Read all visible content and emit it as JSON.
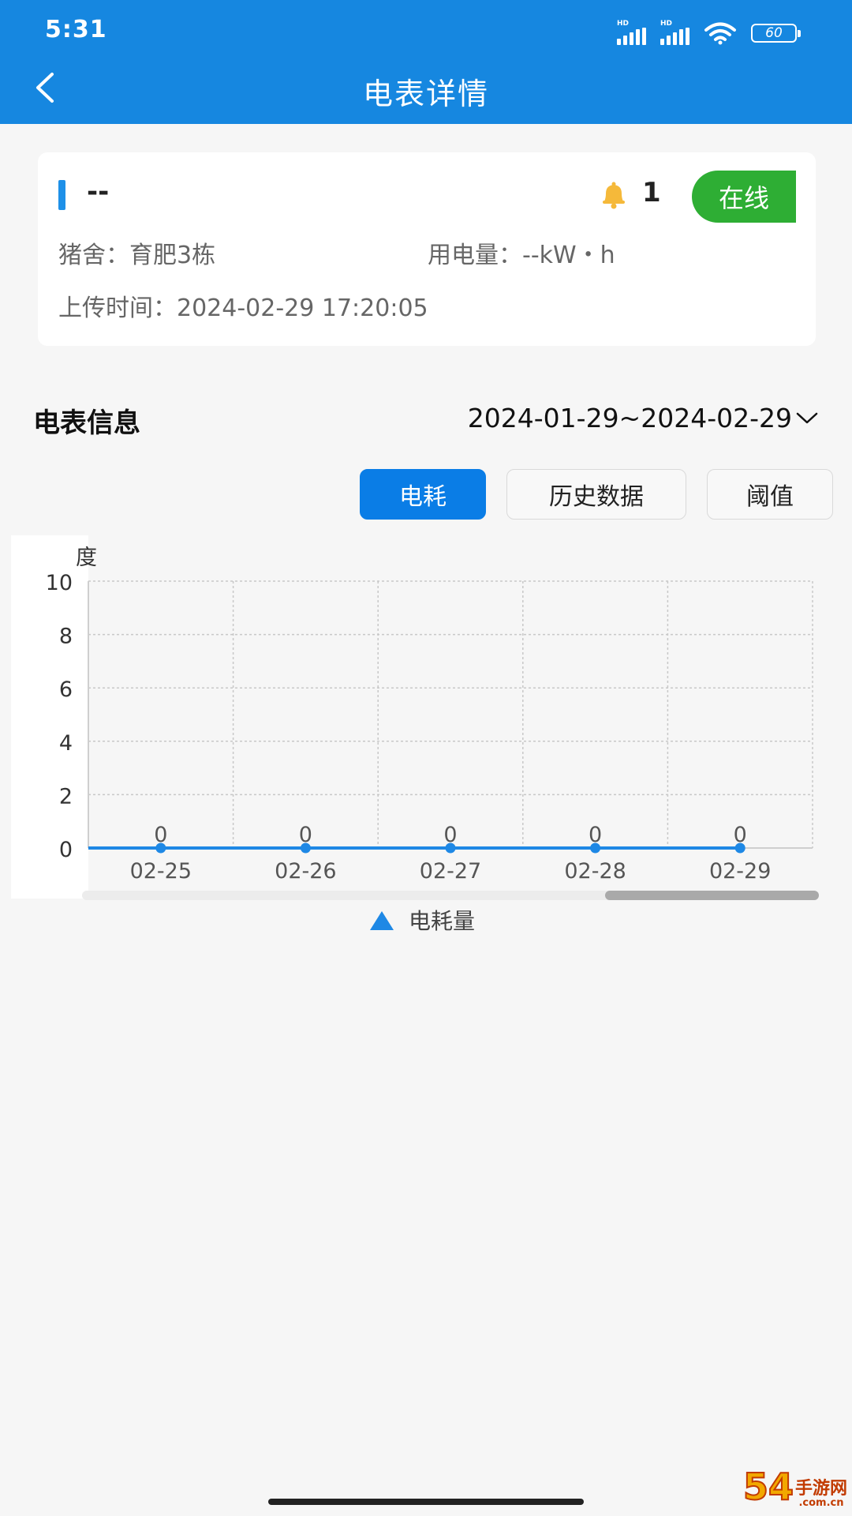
{
  "status_bar": {
    "time": "5:31",
    "hd_label": "HD",
    "battery": "60"
  },
  "header": {
    "title": "电表详情",
    "back_icon": "chevron-left-icon"
  },
  "meter_card": {
    "name": "--",
    "alarm_count": "1",
    "status": "在线",
    "pig_house_label": "猪舍：",
    "pig_house_value": "育肥3栋",
    "usage_label": "用电量：",
    "usage_value": "--kW・h",
    "upload_label": "上传时间：",
    "upload_value": "2024-02-29 17:20:05",
    "colors": {
      "accent": "#1e90e8",
      "online": "#2eae34",
      "bell": "#f5b93a"
    }
  },
  "section": {
    "title": "电表信息",
    "date_range": "2024-01-29~2024-02-29"
  },
  "tabs": [
    {
      "label": "电耗",
      "active": true
    },
    {
      "label": "历史数据",
      "active": false
    },
    {
      "label": "阈值",
      "active": false
    }
  ],
  "chart_data": {
    "type": "line",
    "ylabel": "度",
    "ylim": [
      0,
      10
    ],
    "yticks": [
      0,
      2,
      4,
      6,
      8,
      10
    ],
    "categories": [
      "02-25",
      "02-26",
      "02-27",
      "02-28",
      "02-29"
    ],
    "series": [
      {
        "name": "电耗量",
        "values": [
          0,
          0,
          0,
          0,
          0
        ],
        "color": "#1e88e5"
      }
    ],
    "data_labels": true,
    "grid": true,
    "legend": "bottom-center"
  },
  "watermark": {
    "main": "54",
    "cn": "手游网",
    "domain": ".com.cn"
  }
}
